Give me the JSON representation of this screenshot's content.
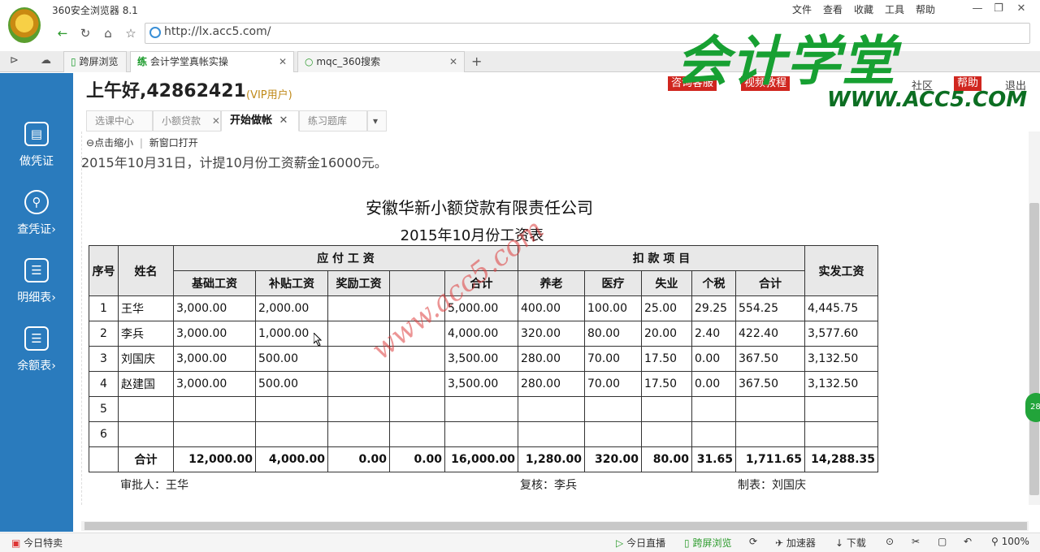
{
  "window": {
    "app_title": "360安全浏览器 8.1",
    "menus": [
      "文件",
      "查看",
      "收藏",
      "工具",
      "帮助"
    ],
    "minimize": "—",
    "restore": "❐",
    "close": "✕"
  },
  "address": {
    "url": "http://lx.acc5.com/"
  },
  "browser_tabs": [
    {
      "label": "跨屏浏览",
      "active": false
    },
    {
      "label": "会计学堂真帐实操",
      "active": true
    },
    {
      "label": "mqc_360搜索",
      "active": false
    }
  ],
  "new_tab": "+",
  "header": {
    "greeting": "上午好,42862421",
    "vip": "(VIP用户)",
    "links": {
      "consult": "咨询客服",
      "video": "视频教程",
      "community": "社区",
      "help": "帮助",
      "logout": "退出"
    }
  },
  "watermark": {
    "logo": "会计学堂",
    "url": "WWW.ACC5.COM",
    "diagonal": "www.acc5.com"
  },
  "inner_tabs": [
    {
      "label": "选课中心",
      "active": false
    },
    {
      "label": "小额贷款",
      "active": false
    },
    {
      "label": "开始做帐",
      "active": true
    },
    {
      "label": "练习题库",
      "active": false
    }
  ],
  "sidebar": {
    "items": [
      {
        "label": "做凭证",
        "icon": "voucher-icon"
      },
      {
        "label": "查凭证",
        "icon": "search-icon"
      },
      {
        "label": "明细表",
        "icon": "list-icon"
      },
      {
        "label": "余额表",
        "icon": "ledger-icon"
      }
    ]
  },
  "doc": {
    "zoom": "点击缩小",
    "open_new": "新窗口打开",
    "instruction": "2015年10月31日，计提10月份工资薪金16000元。",
    "company": "安徽华新小额贷款有限责任公司",
    "title": "2015年10月份工资表",
    "headers": {
      "no": "序号",
      "name": "姓名",
      "payable": "应    付    工    资",
      "deduct": "扣  款  项  目",
      "net": "实发工资",
      "base": "基础工资",
      "subsidy": "补贴工资",
      "bonus": "奖励工资",
      "sum": "合计",
      "pension": "养老",
      "medical": "医疗",
      "unemp": "失业",
      "tax": "个税",
      "dsum": "合计"
    },
    "rows": [
      {
        "no": "1",
        "name": "王华",
        "base": "3,000.00",
        "subsidy": "2,000.00",
        "bonus": "",
        "blank": "",
        "sum": "5,000.00",
        "pension": "400.00",
        "medical": "100.00",
        "unemp": "25.00",
        "tax": "29.25",
        "dsum": "554.25",
        "net": "4,445.75"
      },
      {
        "no": "2",
        "name": "李兵",
        "base": "3,000.00",
        "subsidy": "1,000.00",
        "bonus": "",
        "blank": "",
        "sum": "4,000.00",
        "pension": "320.00",
        "medical": "80.00",
        "unemp": "20.00",
        "tax": "2.40",
        "dsum": "422.40",
        "net": "3,577.60"
      },
      {
        "no": "3",
        "name": "刘国庆",
        "base": "3,000.00",
        "subsidy": "500.00",
        "bonus": "",
        "blank": "",
        "sum": "3,500.00",
        "pension": "280.00",
        "medical": "70.00",
        "unemp": "17.50",
        "tax": "0.00",
        "dsum": "367.50",
        "net": "3,132.50"
      },
      {
        "no": "4",
        "name": "赵建国",
        "base": "3,000.00",
        "subsidy": "500.00",
        "bonus": "",
        "blank": "",
        "sum": "3,500.00",
        "pension": "280.00",
        "medical": "70.00",
        "unemp": "17.50",
        "tax": "0.00",
        "dsum": "367.50",
        "net": "3,132.50"
      },
      {
        "no": "5",
        "name": "",
        "base": "",
        "subsidy": "",
        "bonus": "",
        "blank": "",
        "sum": "",
        "pension": "",
        "medical": "",
        "unemp": "",
        "tax": "",
        "dsum": "",
        "net": ""
      },
      {
        "no": "6",
        "name": "",
        "base": "",
        "subsidy": "",
        "bonus": "",
        "blank": "",
        "sum": "",
        "pension": "",
        "medical": "",
        "unemp": "",
        "tax": "",
        "dsum": "",
        "net": ""
      }
    ],
    "totals": {
      "label": "合计",
      "base": "12,000.00",
      "subsidy": "4,000.00",
      "bonus": "0.00",
      "blank": "0.00",
      "sum": "16,000.00",
      "pension": "1,280.00",
      "medical": "320.00",
      "unemp": "80.00",
      "tax": "31.65",
      "dsum": "1,711.65",
      "net": "14,288.35"
    },
    "signatures": {
      "approver": "审批人：王华",
      "reviewer": "复核：李兵",
      "maker": "制表：刘国庆"
    }
  },
  "statusbar": {
    "left": "今日特卖",
    "live": "今日直播",
    "cross": "跨屏浏览",
    "accel": "加速器",
    "download": "下载",
    "zoom": "100%"
  }
}
